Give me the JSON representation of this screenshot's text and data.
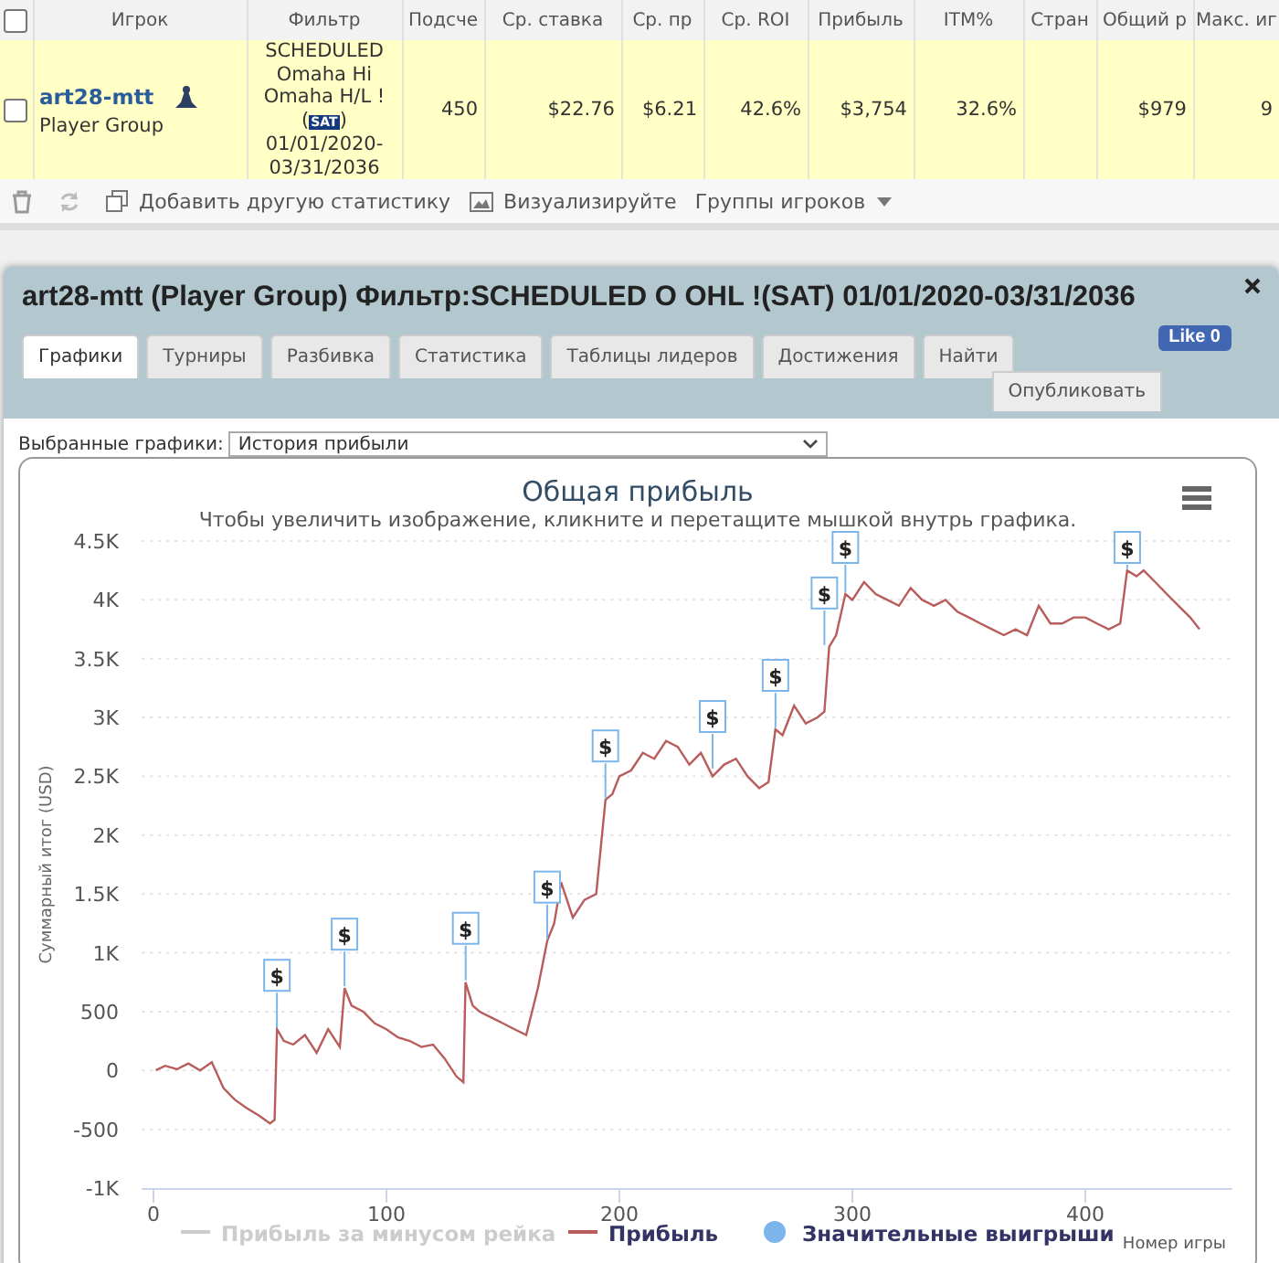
{
  "table": {
    "header_checkbox": {
      "checked": false
    },
    "columns": [
      {
        "label": "Игрок"
      },
      {
        "label": "Фильтр"
      },
      {
        "label": "Подсче"
      },
      {
        "label": "Ср. ставка"
      },
      {
        "label": "Ср. пр"
      },
      {
        "label": "Ср. ROI"
      },
      {
        "label": "Прибыль"
      },
      {
        "label": "ITM%"
      },
      {
        "label": "Стран"
      },
      {
        "label": "Общий р"
      },
      {
        "label": "Макс. иг"
      }
    ],
    "rows": [
      {
        "selected": true,
        "checked": false,
        "cells": [
          {
            "kind": "player",
            "text": "art28-mtt",
            "subtext": "Player Group"
          },
          {
            "kind": "filter",
            "before": "SCHEDULED Omaha Hi Omaha H/L !(",
            "badge": "SAT",
            "after": ") 01/01/2020-03/31/2036"
          },
          {
            "kind": "text",
            "text": "450"
          },
          {
            "kind": "text",
            "text": "$22.76"
          },
          {
            "kind": "text",
            "text": "$6.21"
          },
          {
            "kind": "text",
            "text": "42.6%"
          },
          {
            "kind": "text",
            "text": "$3,754"
          },
          {
            "kind": "text",
            "text": "32.6%"
          },
          {
            "kind": "text",
            "text": ""
          },
          {
            "kind": "text",
            "text": "$979"
          },
          {
            "kind": "text",
            "text": "9"
          }
        ]
      }
    ]
  },
  "toolbar": [
    {
      "kind": "trash"
    },
    {
      "kind": "refresh"
    },
    {
      "kind": "add",
      "label": "Добавить другую статистику"
    },
    {
      "kind": "visualize",
      "label": "Визуализируйте"
    },
    {
      "kind": "dropdown",
      "label": "Группы игроков"
    }
  ],
  "dialog": {
    "title": "art28-mtt (Player Group) Фильтр:SCHEDULED O OHL !(SAT) 01/01/2020-03/31/2036",
    "like": "Like 0",
    "tabs": [
      {
        "label": "Графики",
        "selected": true
      },
      {
        "label": "Турниры",
        "selected": false
      },
      {
        "label": "Разбивка",
        "selected": false
      },
      {
        "label": "Статистика",
        "selected": false
      },
      {
        "label": "Таблицы лидеров",
        "selected": false
      },
      {
        "label": "Достижения",
        "selected": false
      },
      {
        "label": "Найти",
        "selected": false
      }
    ],
    "publish": "Опубликовать",
    "selector": {
      "label": "Выбранные графики:",
      "value": "История прибыли"
    },
    "chart": {
      "subtitle": "Чтобы увеличить изображение, кликните и перетащите мышкой внутрь графика.",
      "legend": [
        {
          "kind": "line",
          "label": "Прибыль за минусом рейка",
          "hidden": true
        },
        {
          "kind": "series"
        },
        {
          "kind": "dot",
          "label": "Значительные выигрыши",
          "hidden": false
        }
      ],
      "chart_data": {
        "type": "line",
        "title": "Общая прибыль",
        "xlabel": "Номер игры",
        "ylabel": "Суммарный итог (USD)",
        "grid": true,
        "xlim": [
          -5,
          463
        ],
        "ylim": [
          -1000,
          4500
        ],
        "xticks": [
          0,
          100,
          200,
          300,
          400
        ],
        "yticks": [
          {
            "value": -1000,
            "label": "-1K"
          },
          {
            "value": -500,
            "label": "-500"
          },
          {
            "value": 0,
            "label": "0"
          },
          {
            "value": 500,
            "label": "500"
          },
          {
            "value": 1000,
            "label": "1K"
          },
          {
            "value": 1500,
            "label": "1.5K"
          },
          {
            "value": 2000,
            "label": "2K"
          },
          {
            "value": 2500,
            "label": "2.5K"
          },
          {
            "value": 3000,
            "label": "3K"
          },
          {
            "value": 3500,
            "label": "3.5K"
          },
          {
            "value": 4000,
            "label": "4K"
          },
          {
            "value": 4500,
            "label": "4.5K"
          }
        ],
        "x": [
          1,
          5,
          10,
          15,
          20,
          25,
          30,
          35,
          40,
          45,
          50,
          52,
          53,
          56,
          60,
          65,
          70,
          75,
          80,
          82,
          85,
          90,
          95,
          100,
          105,
          110,
          115,
          120,
          125,
          130,
          133,
          134,
          137,
          140,
          145,
          150,
          155,
          160,
          165,
          169,
          172,
          175,
          180,
          185,
          190,
          194,
          197,
          200,
          205,
          210,
          215,
          220,
          225,
          230,
          235,
          240,
          245,
          250,
          255,
          260,
          264,
          267,
          270,
          275,
          280,
          285,
          288,
          290,
          293,
          297,
          300,
          305,
          310,
          315,
          320,
          325,
          330,
          335,
          340,
          345,
          350,
          355,
          360,
          365,
          370,
          375,
          380,
          385,
          390,
          395,
          400,
          405,
          410,
          415,
          418,
          422,
          425,
          430,
          435,
          440,
          445,
          449
        ],
        "series": [
          {
            "name": "Прибыль",
            "color": "#b85c5c",
            "values": [
              0,
              40,
              10,
              60,
              0,
              70,
              -150,
              -250,
              -320,
              -380,
              -450,
              -420,
              350,
              250,
              220,
              300,
              150,
              350,
              200,
              700,
              550,
              500,
              400,
              350,
              280,
              250,
              200,
              220,
              100,
              -50,
              -100,
              750,
              550,
              500,
              450,
              400,
              350,
              300,
              700,
              1100,
              1250,
              1600,
              1300,
              1450,
              1500,
              2300,
              2350,
              2500,
              2550,
              2700,
              2650,
              2800,
              2750,
              2600,
              2700,
              2500,
              2600,
              2650,
              2500,
              2400,
              2450,
              2900,
              2850,
              3100,
              2950,
              3000,
              3050,
              3600,
              3700,
              4050,
              4000,
              4150,
              4050,
              4000,
              3950,
              4100,
              4000,
              3950,
              4000,
              3900,
              3850,
              3800,
              3750,
              3700,
              3750,
              3700,
              3950,
              3800,
              3800,
              3850,
              3850,
              3800,
              3750,
              3800,
              4250,
              4200,
              4250,
              4150,
              4050,
              3950,
              3850,
              3750
            ]
          }
        ],
        "annotations": [
          {
            "x": 53,
            "y": 350,
            "text": "$"
          },
          {
            "x": 82,
            "y": 700,
            "text": "$"
          },
          {
            "x": 134,
            "y": 750,
            "text": "$"
          },
          {
            "x": 169,
            "y": 1100,
            "text": "$"
          },
          {
            "x": 194,
            "y": 2300,
            "text": "$"
          },
          {
            "x": 240,
            "y": 2550,
            "text": "$"
          },
          {
            "x": 267,
            "y": 2900,
            "text": "$"
          },
          {
            "x": 288,
            "y": 3600,
            "text": "$"
          },
          {
            "x": 297,
            "y": 4050,
            "text": "$"
          },
          {
            "x": 418,
            "y": 4250,
            "text": "$"
          }
        ]
      }
    }
  }
}
